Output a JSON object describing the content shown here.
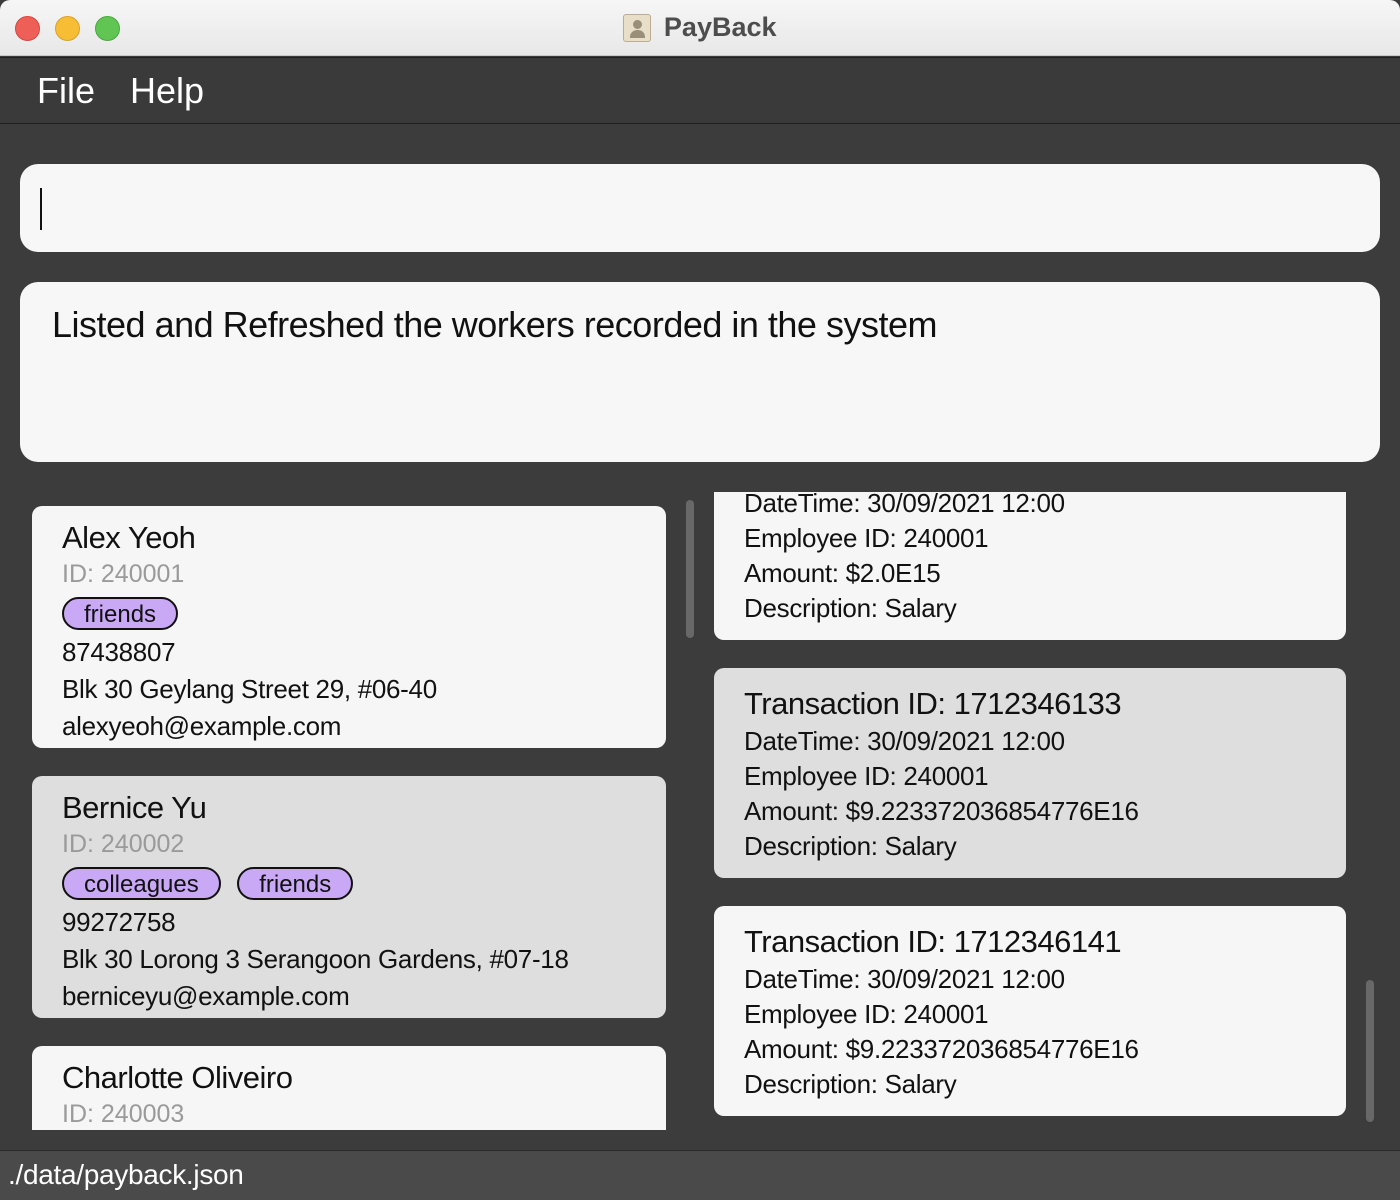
{
  "window": {
    "title": "PayBack",
    "app_icon": "contact-book-icon"
  },
  "menu": {
    "file": "File",
    "help": "Help"
  },
  "command": {
    "value": "",
    "placeholder": ""
  },
  "result": {
    "message": "Listed and Refreshed the workers recorded in the system"
  },
  "persons": [
    {
      "name": "Alex Yeoh",
      "id": "ID: 240001",
      "tags": [
        "friends"
      ],
      "phone": "87438807",
      "address": "Blk 30 Geylang Street 29, #06-40",
      "email": "alexyeoh@example.com"
    },
    {
      "name": "Bernice Yu",
      "id": "ID: 240002",
      "tags": [
        "colleagues",
        "friends"
      ],
      "phone": "99272758",
      "address": "Blk 30 Lorong 3 Serangoon Gardens, #07-18",
      "email": "berniceyu@example.com"
    },
    {
      "name": "Charlotte Oliveiro",
      "id": "ID: 240003"
    }
  ],
  "transactions": [
    {
      "datetime": "DateTime: 30/09/2021 12:00",
      "employee": "Employee ID: 240001",
      "amount": "Amount: $2.0E15",
      "description": "Description: Salary"
    },
    {
      "title": "Transaction ID: 1712346133",
      "datetime": "DateTime: 30/09/2021 12:00",
      "employee": "Employee ID: 240001",
      "amount": "Amount: $9.223372036854776E16",
      "description": "Description: Salary"
    },
    {
      "title": "Transaction ID: 1712346141",
      "datetime": "DateTime: 30/09/2021 12:00",
      "employee": "Employee ID: 240001",
      "amount": "Amount: $9.223372036854776E16",
      "description": "Description: Salary"
    }
  ],
  "status": {
    "path": "./data/payback.json"
  },
  "colors": {
    "tag_bg": "#c9a8f6",
    "background": "#3c3c3c",
    "card_light": "#f6f6f6",
    "card_selected": "#dedede"
  }
}
